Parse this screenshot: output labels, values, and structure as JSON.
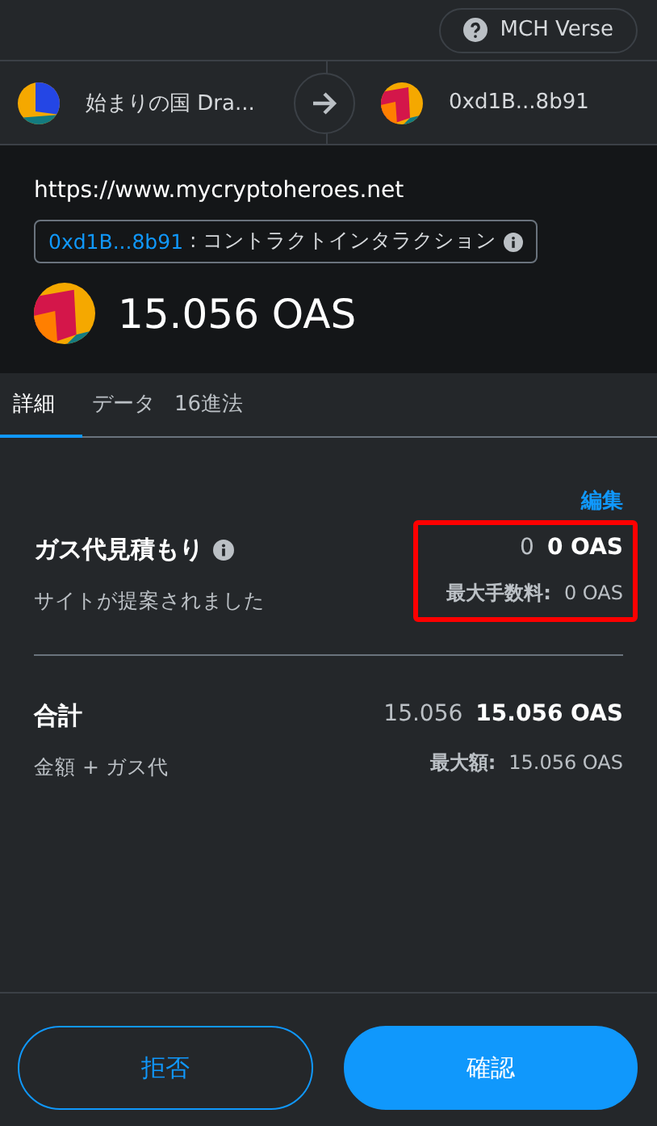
{
  "network": {
    "label": "MCH Verse"
  },
  "from": {
    "name": "始まりの国 Dra..."
  },
  "to": {
    "name": "0xd1B...8b91"
  },
  "site": {
    "origin": "https://www.mycryptoheroes.net",
    "contract_address": "0xd1B...8b91",
    "contract_label": ": コントラクトインタラクション",
    "amount": "15.056 OAS"
  },
  "tabs": [
    {
      "label": "詳細",
      "selected": true
    },
    {
      "label": "データ",
      "selected": false
    },
    {
      "label": "16進法",
      "selected": false
    }
  ],
  "edit_link": "編集",
  "gas": {
    "title": "ガス代見積もり",
    "subtitle": "サイトが提案されました",
    "value": "0",
    "value_bold": "0 OAS",
    "max_label": "最大手数料:",
    "max_value": "0 OAS",
    "highlighted": true
  },
  "total": {
    "title": "合計",
    "subtitle": "金額 + ガス代",
    "value": "15.056",
    "value_bold": "15.056 OAS",
    "max_label": "最大額:",
    "max_value": "15.056 OAS"
  },
  "buttons": [
    {
      "label": "拒否",
      "kind": "secondary"
    },
    {
      "label": "確認",
      "kind": "primary"
    }
  ]
}
